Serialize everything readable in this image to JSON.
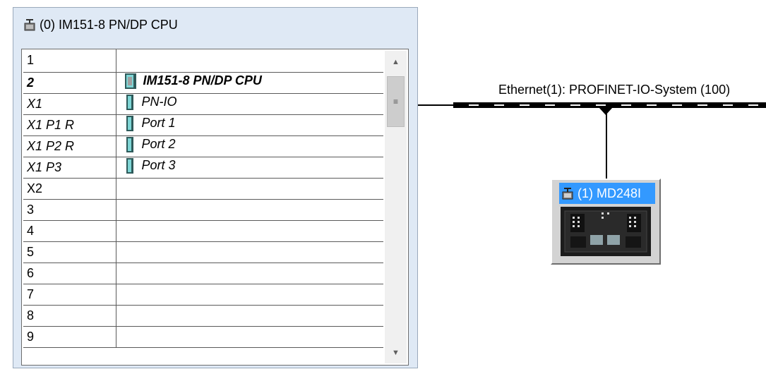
{
  "station": {
    "title": "(0) IM151-8 PN/DP CPU",
    "slots": [
      {
        "slot": "1",
        "module": "",
        "italic": false,
        "bold": false,
        "icon": ""
      },
      {
        "slot": "2",
        "module": "IM151-8 PN/DP CPU",
        "italic": true,
        "bold": true,
        "icon": "cpu-module-icon"
      },
      {
        "slot": "X1",
        "module": "PN-IO",
        "italic": true,
        "bold": false,
        "icon": "interface-module-icon"
      },
      {
        "slot": "X1 P1 R",
        "module": "Port 1",
        "italic": true,
        "bold": false,
        "icon": "port-module-icon"
      },
      {
        "slot": "X1 P2 R",
        "module": "Port 2",
        "italic": true,
        "bold": false,
        "icon": "port-module-icon"
      },
      {
        "slot": "X1 P3",
        "module": "Port 3",
        "italic": true,
        "bold": false,
        "icon": "port-module-icon"
      },
      {
        "slot": "X2",
        "module": "",
        "italic": false,
        "bold": false,
        "icon": ""
      },
      {
        "slot": "3",
        "module": "",
        "italic": false,
        "bold": false,
        "icon": ""
      },
      {
        "slot": "4",
        "module": "",
        "italic": false,
        "bold": false,
        "icon": ""
      },
      {
        "slot": "5",
        "module": "",
        "italic": false,
        "bold": false,
        "icon": ""
      },
      {
        "slot": "6",
        "module": "",
        "italic": false,
        "bold": false,
        "icon": ""
      },
      {
        "slot": "7",
        "module": "",
        "italic": false,
        "bold": false,
        "icon": ""
      },
      {
        "slot": "8",
        "module": "",
        "italic": false,
        "bold": false,
        "icon": ""
      },
      {
        "slot": "9",
        "module": "",
        "italic": false,
        "bold": false,
        "icon": ""
      }
    ]
  },
  "network": {
    "label": "Ethernet(1): PROFINET-IO-System (100)"
  },
  "device": {
    "label": "(1) MD248I",
    "icon": "io-device-icon"
  },
  "colors": {
    "selection": "#3399ff",
    "window_bg": "#dfe9f5",
    "device_bg": "#d3d3d3"
  }
}
